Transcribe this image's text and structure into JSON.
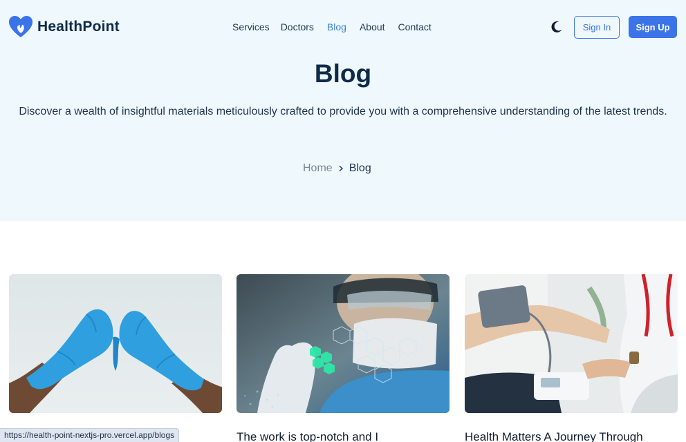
{
  "header": {
    "brand": "HealthPoint",
    "nav": [
      {
        "label": "Services",
        "active": false
      },
      {
        "label": "Doctors",
        "active": false
      },
      {
        "label": "Blog",
        "active": true
      },
      {
        "label": "About",
        "active": false
      },
      {
        "label": "Contact",
        "active": false
      }
    ],
    "theme_icon": "moon-icon",
    "signin_label": "Sign In",
    "signup_label": "Sign Up"
  },
  "hero": {
    "title": "Blog",
    "description": "Discover a wealth of insightful materials meticulously crafted to provide you with a comprehensive understanding of the latest trends.",
    "breadcrumb": {
      "home": "Home",
      "current": "Blog"
    }
  },
  "posts": [
    {
      "title": "",
      "image": "blue-gloved-hands-heart"
    },
    {
      "title": "The work is top-notch and I",
      "image": "scientist-hexagon-molecules"
    },
    {
      "title": "Health Matters A Journey Through",
      "image": "blood-pressure-check"
    }
  ],
  "status_bar": {
    "url": "https://health-point-nextjs-pro.vercel.app/blogs"
  },
  "colors": {
    "accent": "#3b73e8",
    "hero_bg": "#eef8fd",
    "heading": "#0f2a4a"
  }
}
